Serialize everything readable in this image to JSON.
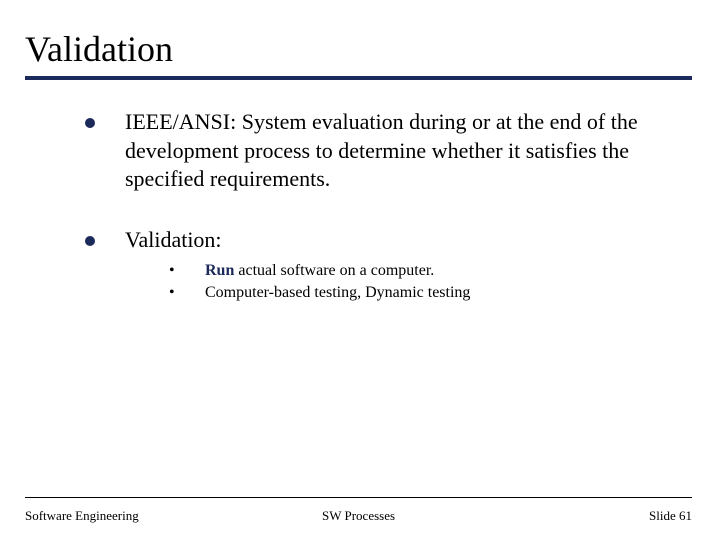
{
  "title": "Validation",
  "bullets": [
    {
      "text": "IEEE/ANSI: System evaluation during or at the end of the development process to determine whether it satisfies the specified requirements."
    },
    {
      "text": "Validation:",
      "sub": [
        {
          "bold": "Run",
          "rest": " actual software on a computer."
        },
        {
          "bold": "",
          "rest": "Computer-based testing, Dynamic testing"
        }
      ]
    }
  ],
  "footer": {
    "left": "Software Engineering",
    "center": "SW Processes",
    "right": "Slide 61"
  }
}
